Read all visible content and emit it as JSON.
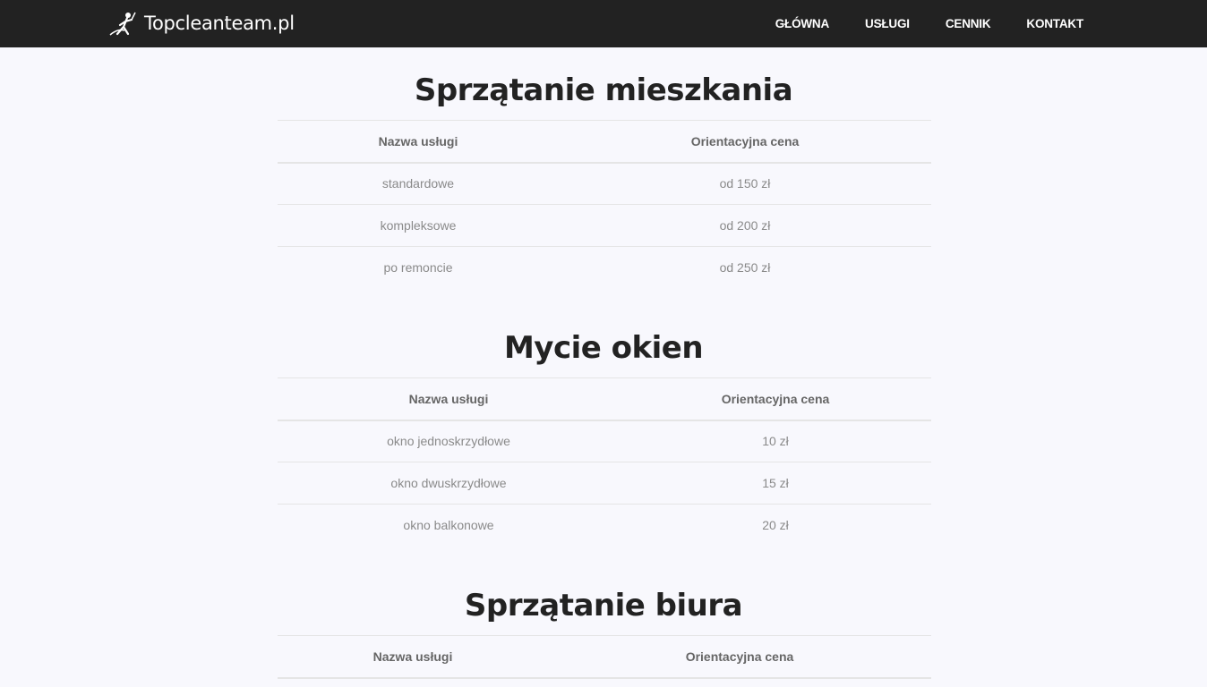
{
  "brand": {
    "name": "Topcleanteam.pl"
  },
  "nav": [
    "GŁÓWNA",
    "USŁUGI",
    "CENNIK",
    "KONTAKT"
  ],
  "sections": [
    {
      "title": "Sprzątanie mieszkania",
      "headers": [
        "Nazwa usługi",
        "Orientacyjna cena"
      ],
      "rows": [
        [
          "standardowe",
          "od 150 zł"
        ],
        [
          "kompleksowe",
          "od 200 zł"
        ],
        [
          "po remoncie",
          "od 250 zł"
        ]
      ]
    },
    {
      "title": "Mycie okien",
      "headers": [
        "Nazwa usługi",
        "Orientacyjna cena"
      ],
      "rows": [
        [
          "okno jednoskrzydłowe",
          "10 zł"
        ],
        [
          "okno dwuskrzydłowe",
          "15 zł"
        ],
        [
          "okno balkonowe",
          "20 zł"
        ]
      ]
    },
    {
      "title": "Sprzątanie biura",
      "headers": [
        "Nazwa usługi",
        "Orientacyjna cena"
      ],
      "rows": []
    }
  ]
}
